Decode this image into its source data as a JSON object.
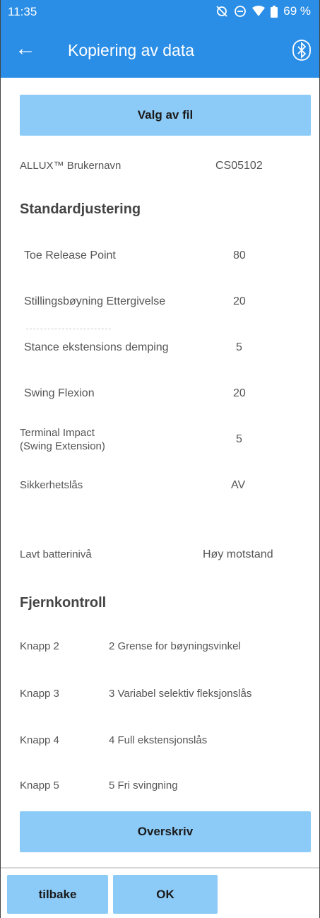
{
  "status": {
    "time": "11:35",
    "battery": "69 %"
  },
  "appbar": {
    "title": "Kopiering av data"
  },
  "select_file_button": "Valg av fil",
  "user": {
    "label": "ALLUX™ Brukernavn",
    "value": "CS05102"
  },
  "standard": {
    "heading": "Standardjustering",
    "rows": [
      {
        "label": "Toe Release Point",
        "value": "80"
      },
      {
        "label": "Stillingsbøyning Ettergivelse",
        "value": "20"
      },
      {
        "label": "Stance ekstensions demping",
        "value": "5"
      },
      {
        "label": "Swing Flexion",
        "value": "20"
      },
      {
        "label_line1": "Terminal Impact",
        "label_line2": "(Swing Extension)",
        "value": "5"
      },
      {
        "label": "Sikkerhetslås",
        "value": "AV"
      }
    ],
    "battery": {
      "label": "Lavt batterinivå",
      "value": "Høy motstand"
    }
  },
  "remote": {
    "heading": "Fjernkontroll",
    "rows": [
      {
        "label": "Knapp 2",
        "value": "2 Grense for bøyningsvinkel"
      },
      {
        "label": "Knapp 3",
        "value": "3 Variabel selektiv fleksjonslås"
      },
      {
        "label": "Knapp 4",
        "value": "4 Full ekstensjonslås"
      },
      {
        "label": "Knapp 5",
        "value": "5 Fri svingning"
      }
    ]
  },
  "overwrite_button": "Overskriv",
  "bottom": {
    "back": "tilbake",
    "ok": "OK"
  },
  "colors": {
    "appbar": "#2b8ee6",
    "button": "#8ccaf7"
  }
}
